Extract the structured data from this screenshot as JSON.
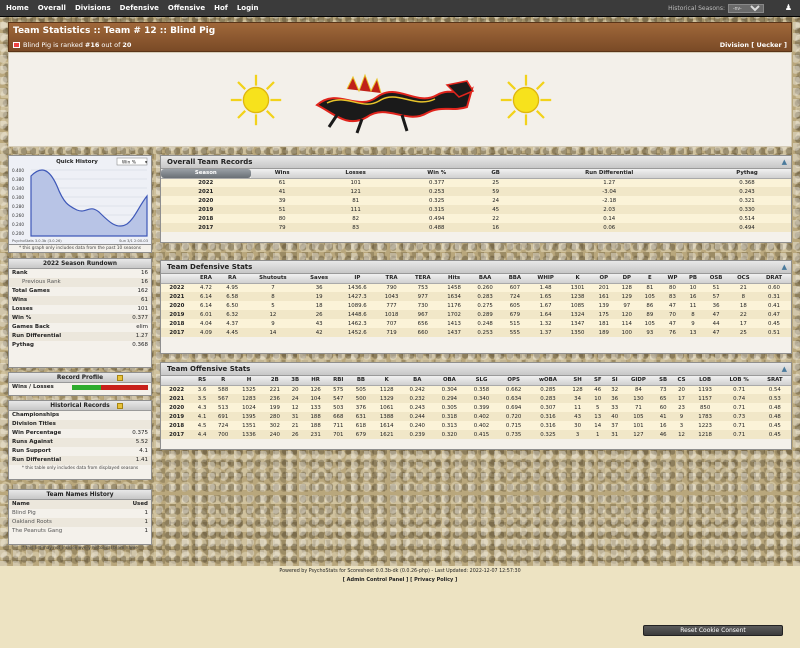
{
  "nav": {
    "items": [
      "Home",
      "Overall",
      "Divisions",
      "Defensive",
      "Offensive",
      "Hof",
      "Login"
    ],
    "historical_label": "Historical Seasons:",
    "historical_value": "-nv-"
  },
  "header": {
    "title": "Team Statistics :: Team # 12 :: Blind Pig",
    "team": "Blind Pig",
    "ranked_text": "is ranked",
    "rank": "#16",
    "out_of": "out of",
    "total": "20",
    "division": "Division [ Uecker ]"
  },
  "quick_history": {
    "title": "Quick History",
    "mode": "Win %",
    "yticks": [
      "0.400",
      "0.380",
      "0.340",
      "0.300",
      "0.280",
      "0.260",
      "0.240",
      "0.200"
    ],
    "note": "* this graph only includes data from the past 10 seasons",
    "footer_left": "PsychoStats 3.0.3b (3.0.26)",
    "footer_right": "Sun 3/1 2:00-03"
  },
  "rundown": {
    "title": "2022 Season Rundown",
    "rows": [
      {
        "l": "Rank",
        "v": "16",
        "in": false
      },
      {
        "l": "Previous Rank",
        "v": "16",
        "in": true
      },
      {
        "l": "Total Games",
        "v": "162",
        "in": false
      },
      {
        "l": "Wins",
        "v": "61",
        "in": false
      },
      {
        "l": "Losses",
        "v": "101",
        "in": false
      },
      {
        "l": "Win %",
        "v": "0.377",
        "in": false
      },
      {
        "l": "Games Back",
        "v": "elim",
        "in": false
      },
      {
        "l": "Run Differential",
        "v": "1.27",
        "in": false
      },
      {
        "l": "Pythag",
        "v": "0.368",
        "in": false
      }
    ]
  },
  "record_profile": {
    "title": "Record Profile",
    "label": "Wins / Losses",
    "win_pct": 0.377
  },
  "historical": {
    "title": "Historical Records",
    "rows": [
      {
        "l": "Championships",
        "v": ""
      },
      {
        "l": "Division Titles",
        "v": ""
      },
      {
        "l": "Win Percentage",
        "v": "0.375"
      },
      {
        "l": "Runs Against",
        "v": "5.52"
      },
      {
        "l": "Run Support",
        "v": "4.1"
      },
      {
        "l": "Run Differential",
        "v": "1.41"
      }
    ],
    "note": "* this table only includes data from displayed seasons"
  },
  "names": {
    "title": "Team Names History",
    "col_name": "Name",
    "col_used": "Used",
    "rows": [
      {
        "n": "Blind Pig",
        "u": "1"
      },
      {
        "n": "Oakland Roots",
        "u": "1"
      },
      {
        "n": "The Peanuts Gang",
        "u": "1"
      }
    ],
    "note": "* this list may not include every historical team name"
  },
  "overall": {
    "title": "Overall Team Records",
    "cols": [
      "Season",
      "Wins",
      "Losses",
      "Win %",
      "GB",
      "Run Differential",
      "Pythag"
    ],
    "rows": [
      [
        "2022",
        "61",
        "101",
        "0.377",
        "25",
        "1.27",
        "0.368"
      ],
      [
        "2021",
        "41",
        "121",
        "0.253",
        "59",
        "-3.04",
        "0.243"
      ],
      [
        "2020",
        "39",
        "81",
        "0.325",
        "24",
        "-2.18",
        "0.321"
      ],
      [
        "2019",
        "51",
        "111",
        "0.315",
        "45",
        "2.03",
        "0.330"
      ],
      [
        "2018",
        "80",
        "82",
        "0.494",
        "22",
        "0.14",
        "0.514"
      ],
      [
        "2017",
        "79",
        "83",
        "0.488",
        "16",
        "0.06",
        "0.494"
      ]
    ]
  },
  "defensive": {
    "title": "Team Defensive Stats",
    "cols": [
      "",
      "ERA",
      "RA",
      "Shutouts",
      "Saves",
      "IP",
      "TRA",
      "TERA",
      "Hits",
      "BAA",
      "BBA",
      "WHIP",
      "K",
      "OP",
      "DP",
      "E",
      "WP",
      "PB",
      "OSB",
      "OCS",
      "DRAT"
    ],
    "rows": [
      [
        "2022",
        "4.72",
        "4.95",
        "7",
        "36",
        "1436.6",
        "790",
        "753",
        "1458",
        "0.260",
        "607",
        "1.48",
        "1301",
        "201",
        "128",
        "81",
        "80",
        "10",
        "51",
        "21",
        "0.60"
      ],
      [
        "2021",
        "6.14",
        "6.58",
        "8",
        "19",
        "1427.3",
        "1043",
        "977",
        "1634",
        "0.283",
        "724",
        "1.65",
        "1238",
        "161",
        "129",
        "105",
        "83",
        "16",
        "57",
        "8",
        "0.31"
      ],
      [
        "2020",
        "6.14",
        "6.50",
        "5",
        "18",
        "1089.6",
        "777",
        "730",
        "1176",
        "0.275",
        "605",
        "1.67",
        "1085",
        "139",
        "97",
        "86",
        "47",
        "11",
        "36",
        "18",
        "0.41"
      ],
      [
        "2019",
        "6.01",
        "6.32",
        "12",
        "26",
        "1448.6",
        "1018",
        "967",
        "1702",
        "0.289",
        "679",
        "1.64",
        "1324",
        "175",
        "120",
        "89",
        "70",
        "8",
        "47",
        "22",
        "0.47"
      ],
      [
        "2018",
        "4.04",
        "4.37",
        "9",
        "43",
        "1462.3",
        "707",
        "656",
        "1413",
        "0.248",
        "515",
        "1.32",
        "1347",
        "181",
        "114",
        "105",
        "47",
        "9",
        "44",
        "17",
        "0.45"
      ],
      [
        "2017",
        "4.09",
        "4.45",
        "14",
        "42",
        "1452.6",
        "719",
        "660",
        "1437",
        "0.253",
        "555",
        "1.37",
        "1350",
        "189",
        "100",
        "93",
        "76",
        "13",
        "47",
        "25",
        "0.51"
      ]
    ]
  },
  "offensive": {
    "title": "Team Offensive Stats",
    "cols": [
      "",
      "RS",
      "R",
      "H",
      "2B",
      "3B",
      "HR",
      "RBI",
      "BB",
      "K",
      "BA",
      "OBA",
      "SLG",
      "OPS",
      "wOBA",
      "SH",
      "SF",
      "SI",
      "GIDP",
      "SB",
      "CS",
      "LOB",
      "LOB %",
      "SRAT"
    ],
    "rows": [
      [
        "2022",
        "3.6",
        "588",
        "1325",
        "221",
        "20",
        "126",
        "575",
        "505",
        "1128",
        "0.242",
        "0.304",
        "0.358",
        "0.662",
        "0.285",
        "128",
        "46",
        "32",
        "84",
        "73",
        "20",
        "1193",
        "0.71",
        "0.54"
      ],
      [
        "2021",
        "3.5",
        "567",
        "1283",
        "236",
        "24",
        "104",
        "547",
        "500",
        "1329",
        "0.232",
        "0.294",
        "0.340",
        "0.634",
        "0.283",
        "34",
        "10",
        "36",
        "130",
        "65",
        "17",
        "1157",
        "0.74",
        "0.53"
      ],
      [
        "2020",
        "4.3",
        "513",
        "1024",
        "199",
        "12",
        "133",
        "503",
        "376",
        "1061",
        "0.243",
        "0.305",
        "0.399",
        "0.694",
        "0.307",
        "11",
        "5",
        "33",
        "71",
        "60",
        "23",
        "850",
        "0.71",
        "0.48"
      ],
      [
        "2019",
        "4.1",
        "691",
        "1395",
        "280",
        "31",
        "188",
        "668",
        "631",
        "1388",
        "0.244",
        "0.318",
        "0.402",
        "0.720",
        "0.316",
        "43",
        "13",
        "40",
        "105",
        "41",
        "9",
        "1783",
        "0.73",
        "0.48"
      ],
      [
        "2018",
        "4.5",
        "724",
        "1351",
        "302",
        "21",
        "188",
        "711",
        "618",
        "1614",
        "0.240",
        "0.313",
        "0.402",
        "0.715",
        "0.316",
        "30",
        "14",
        "37",
        "101",
        "16",
        "3",
        "1223",
        "0.71",
        "0.45"
      ],
      [
        "2017",
        "4.4",
        "700",
        "1336",
        "240",
        "26",
        "231",
        "701",
        "679",
        "1621",
        "0.239",
        "0.320",
        "0.415",
        "0.735",
        "0.325",
        "3",
        "1",
        "31",
        "127",
        "46",
        "12",
        "1218",
        "0.71",
        "0.45"
      ]
    ]
  },
  "footer": {
    "powered": "Powered by PsychoStats for Scoresheet 0.0.3b-dk (0.0.26-php) - Last Updated: 2022-12-07 12:57:30",
    "links": "[ Admin Control Panel ] [ Privacy Policy ]",
    "cookie": "Reset Cookie Consent"
  }
}
